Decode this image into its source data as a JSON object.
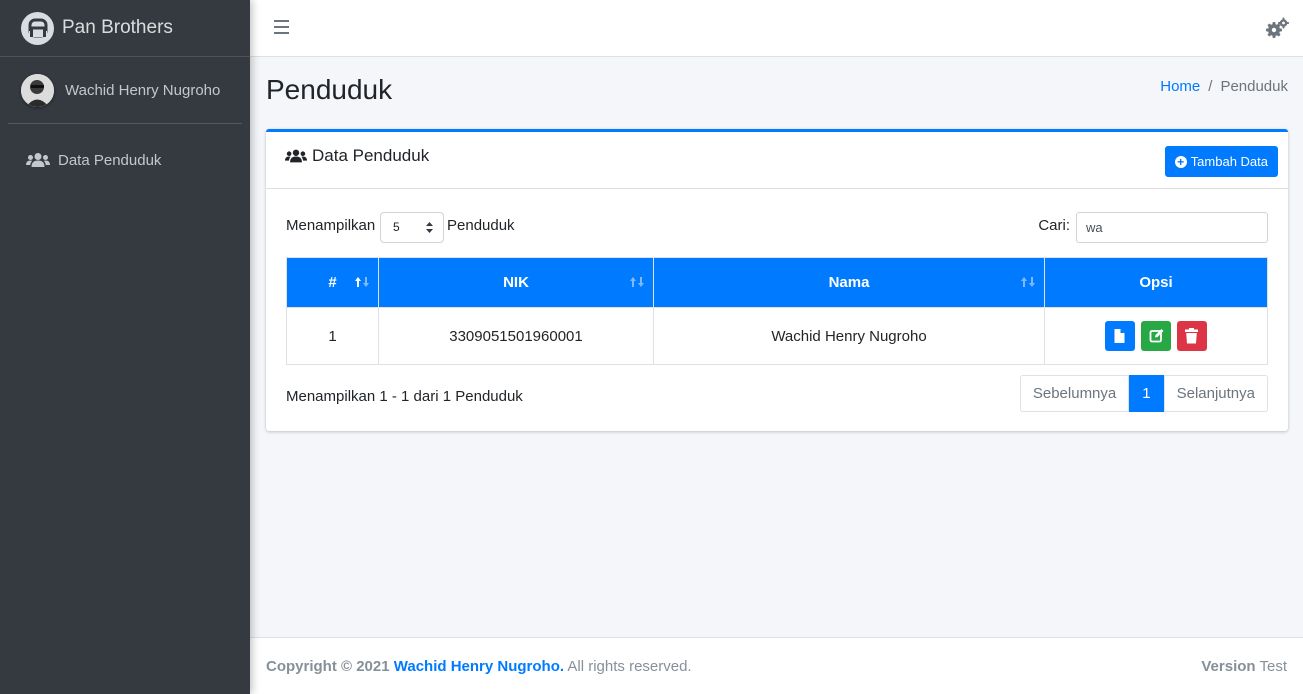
{
  "brand": {
    "name": "Pan Brothers"
  },
  "user": {
    "name": "Wachid Henry Nugroho"
  },
  "sidebar": {
    "items": [
      {
        "label": "Data Penduduk",
        "icon": "users-icon"
      }
    ]
  },
  "topbar": {
    "menu_icon": "bars-icon",
    "settings_icon": "cogs-icon"
  },
  "page": {
    "title": "Penduduk"
  },
  "breadcrumb": {
    "home": "Home",
    "separator": "/",
    "current": "Penduduk"
  },
  "card": {
    "title": "Data Penduduk",
    "add_button": "Tambah Data"
  },
  "controls": {
    "show_label": "Menampilkan",
    "entries_value": "5",
    "show_suffix": "Penduduk",
    "search_label": "Cari:",
    "search_value": "wa"
  },
  "table": {
    "headers": [
      "#",
      "NIK",
      "Nama",
      "Opsi"
    ],
    "rows": [
      {
        "no": "1",
        "nik": "3309051501960001",
        "nama": "Wachid Henry Nugroho"
      }
    ]
  },
  "info": "Menampilkan 1 - 1 dari 1 Penduduk",
  "pagination": {
    "prev": "Sebelumnya",
    "current": "1",
    "next": "Selanjutnya"
  },
  "footer": {
    "copyright": "Copyright © 2021",
    "author": "Wachid Henry Nugroho.",
    "rights": "All rights reserved.",
    "version_label": "Version",
    "version_value": "Test"
  },
  "colors": {
    "primary": "#007bff",
    "success": "#28a745",
    "danger": "#dc3545",
    "sidebar": "#343a40"
  }
}
